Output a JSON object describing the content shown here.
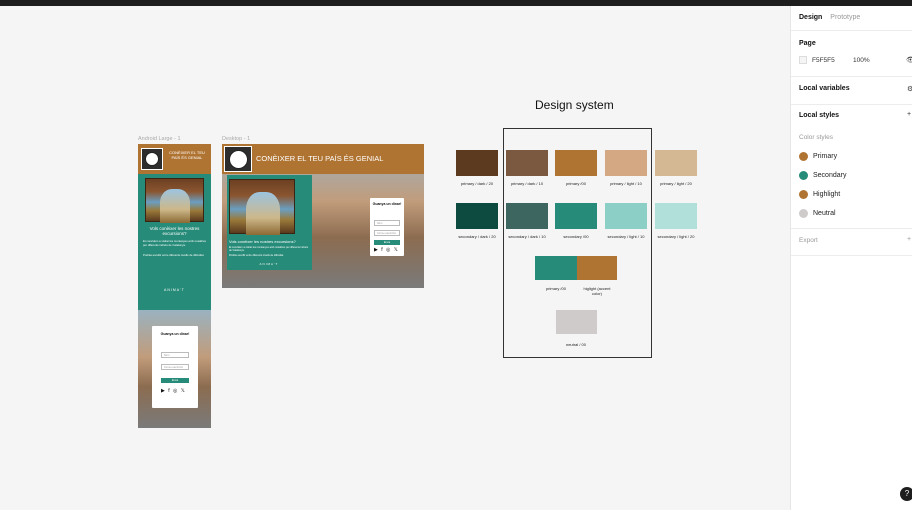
{
  "panel": {
    "tab_design": "Design",
    "tab_prototype": "Prototype",
    "page_title": "Page",
    "page_color": "F5F5F5",
    "page_opacity": "100%",
    "local_variables": "Local variables",
    "local_styles": "Local styles",
    "color_styles": "Color styles",
    "styles": [
      {
        "name": "Primary",
        "color": "#b07432"
      },
      {
        "name": "Secondary",
        "color": "#268b78"
      },
      {
        "name": "Highlight",
        "color": "#b07432"
      },
      {
        "name": "Neutral",
        "color": "#d0cbcb"
      }
    ],
    "export": "Export",
    "help": "?"
  },
  "frames": {
    "android_label": "Android Large - 1",
    "desktop_label": "Desktop - 1"
  },
  "android": {
    "header_title": "CONÈIXER EL TEU PAÍS ÉS GENIAL",
    "hero_heading": "Vols conèixer les nostres excursions?",
    "hero_text1": "Et convidem a visitar les muntanyes amb nosaltres per diferents indrets de Catalunya.",
    "hero_text2": "Podràs escollir entre diferents nivells de dificultat.",
    "brand": "ANIMA'T",
    "card_title": "Guanya un dinar!",
    "input_name": "Nom",
    "input_email": "Correu electrònic",
    "button": "Envia",
    "social": "▶ f ◎ 𝕏"
  },
  "desktop": {
    "header_title": "CONÈIXER EL TEU PAÍS ÉS GENIAL",
    "hero_heading": "Vols conèixer les nostres excursions?",
    "hero_text1": "Et convidem a visitar les muntanyes amb nosaltres per diferents indrets de Catalunya.",
    "hero_text2": "Podràs escollir entre diferents nivells de dificultat.",
    "brand": "ANIMA'T",
    "card_title": "Guanya un dinar!",
    "input_name": "Nom",
    "input_email": "Correu electrònic",
    "button": "Envia",
    "social": "▶ f ◎ 𝕏"
  },
  "design_system": {
    "title": "Design system",
    "primary_row": [
      {
        "label": "primary / dark / 20",
        "color": "#5c3a1f"
      },
      {
        "label": "primary / dark / 10",
        "color": "#7b5940"
      },
      {
        "label": "primary /00",
        "color": "#b07432"
      },
      {
        "label": "primary / light / 10",
        "color": "#d4a882"
      },
      {
        "label": "primary / light / 20",
        "color": "#d4b894"
      }
    ],
    "secondary_row": [
      {
        "label": "secondary / dark / 20",
        "color": "#0d4a3f"
      },
      {
        "label": "secondary / dark / 10",
        "color": "#3e6660"
      },
      {
        "label": "secondary /00",
        "color": "#268b78"
      },
      {
        "label": "secondary / light / 10",
        "color": "#8ccfc6"
      },
      {
        "label": "secondary / light / 20",
        "color": "#b1e0da"
      }
    ],
    "combo_primary_label": "primary /00",
    "combo_highlight_label": "higlight (accent color)",
    "combo_primary_color": "#268b78",
    "combo_highlight_color": "#b07432",
    "neutral_label": "neutral / 00",
    "neutral_color": "#d0cbcb"
  }
}
